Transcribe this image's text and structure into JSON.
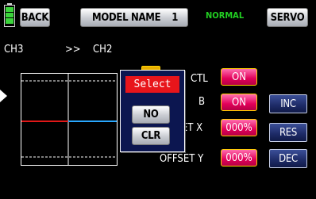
{
  "header": {
    "back_label": "BACK",
    "model_label": "MODEL NAME",
    "model_number": "1",
    "mode_label": "NORMAL",
    "servo_label": "SERVO"
  },
  "channels": {
    "from": "CH3",
    "arrow": ">>",
    "to": "CH2"
  },
  "settings": {
    "ctl_label": "CTL",
    "ctl_value": "ON",
    "b_label": "B",
    "b_value": "ON",
    "offset_x_label": "OFFSET X",
    "offset_x_value": "000%",
    "offset_y_label": "OFFSET Y",
    "offset_y_value": "000%"
  },
  "side_buttons": {
    "inc": "INC",
    "res": "RES",
    "dec": "DEC"
  },
  "popup": {
    "title": "Select",
    "no_label": "NO",
    "clr_label": "CLR"
  },
  "colors": {
    "accent_pink": "#e3005a",
    "mode_green": "#22d022",
    "battery_green": "#3bd43b",
    "popup_red": "#e8151b",
    "graph_red": "#e01818",
    "graph_blue": "#2aa8ff"
  },
  "icons": {
    "battery": "battery-icon",
    "pointer": "pointer-arrow-icon"
  }
}
